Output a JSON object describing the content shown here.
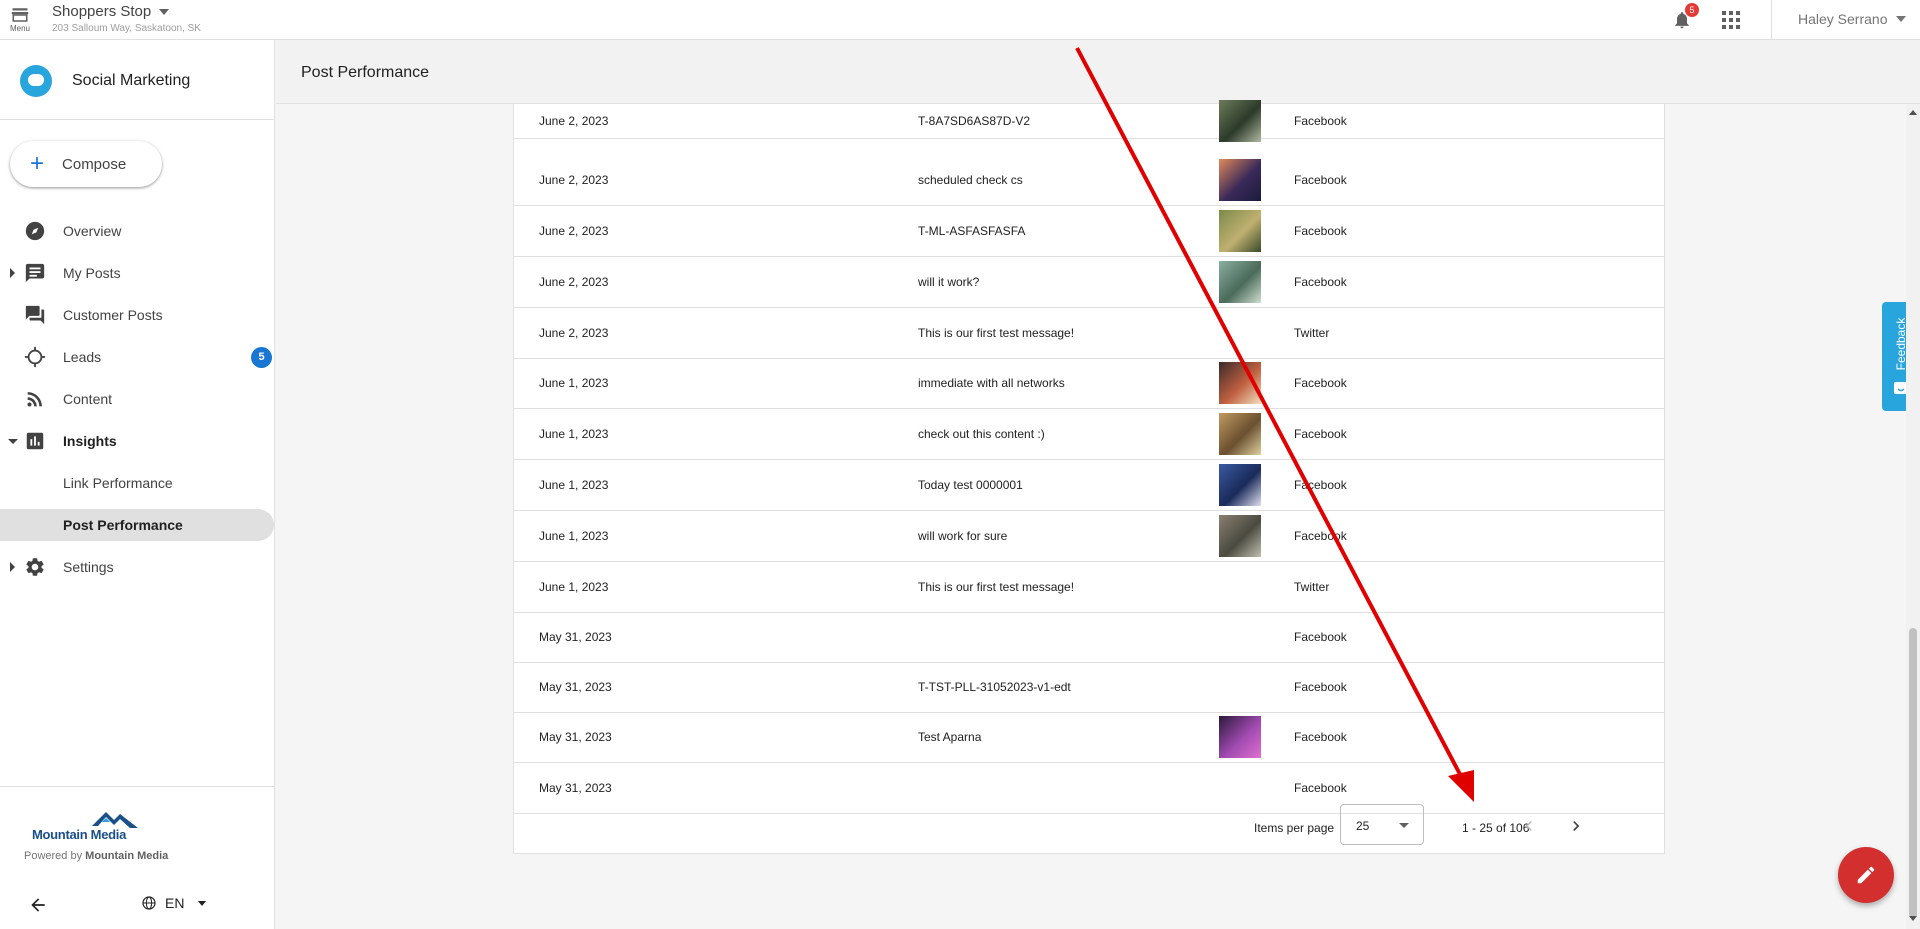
{
  "topbar": {
    "menu_label": "Menu",
    "store_name": "Shoppers Stop",
    "store_address": "203 Salloum Way, Saskatoon, SK",
    "notification_count": "5",
    "user_name": "Haley Serrano"
  },
  "sidebar": {
    "brand_title": "Social Marketing",
    "compose_label": "Compose",
    "items": [
      {
        "label": "Overview",
        "icon": "compass-icon"
      },
      {
        "label": "My Posts",
        "icon": "chat-icon"
      },
      {
        "label": "Customer Posts",
        "icon": "forum-icon"
      },
      {
        "label": "Leads",
        "icon": "crosshair-icon",
        "badge": "5"
      },
      {
        "label": "Content",
        "icon": "rss-icon"
      },
      {
        "label": "Insights",
        "icon": "chart-icon"
      },
      {
        "label": "Link Performance"
      },
      {
        "label": "Post Performance"
      },
      {
        "label": "Settings",
        "icon": "gear-icon"
      }
    ],
    "logo_text": "Mountain Media",
    "powered_prefix": "Powered by",
    "powered_brand": "Mountain Media",
    "language": "EN"
  },
  "page": {
    "title": "Post Performance"
  },
  "table": {
    "rows": [
      {
        "date": "June 2, 2023",
        "message": "T-8A7SD6AS87D-V2",
        "network": "Facebook",
        "thumb": "a"
      },
      {
        "date": "June 2, 2023",
        "message": "scheduled check cs",
        "network": "Facebook",
        "thumb": "b"
      },
      {
        "date": "June 2, 2023",
        "message": "T-ML-ASFASFASFA",
        "network": "Facebook",
        "thumb": "c"
      },
      {
        "date": "June 2, 2023",
        "message": "will it work?",
        "network": "Facebook",
        "thumb": "d"
      },
      {
        "date": "June 2, 2023",
        "message": "This is our first test message!",
        "network": "Twitter",
        "thumb": ""
      },
      {
        "date": "June 1, 2023",
        "message": "immediate with all networks",
        "network": "Facebook",
        "thumb": "e"
      },
      {
        "date": "June 1, 2023",
        "message": "check out this content :)",
        "network": "Facebook",
        "thumb": "f"
      },
      {
        "date": "June 1, 2023",
        "message": "Today test 0000001",
        "network": "Facebook",
        "thumb": "g"
      },
      {
        "date": "June 1, 2023",
        "message": "will work for sure",
        "network": "Facebook",
        "thumb": "h"
      },
      {
        "date": "June 1, 2023",
        "message": "This is our first test message!",
        "network": "Twitter",
        "thumb": ""
      },
      {
        "date": "May 31, 2023",
        "message": "",
        "network": "Facebook",
        "thumb": ""
      },
      {
        "date": "May 31, 2023",
        "message": "T-TST-PLL-31052023-v1-edt",
        "network": "Facebook",
        "thumb": ""
      },
      {
        "date": "May 31, 2023",
        "message": "Test Aparna",
        "network": "Facebook",
        "thumb": "i"
      },
      {
        "date": "May 31, 2023",
        "message": "",
        "network": "Facebook",
        "thumb": ""
      }
    ]
  },
  "pager": {
    "items_per_page_label": "Items per page",
    "items_per_page_value": "25",
    "range_label": "1 - 25 of 106"
  },
  "feedback_label": "Feedback",
  "colors": {
    "accent": "#1976d2",
    "brand": "#29a5dd",
    "fab": "#d32f2f",
    "annotation": "#e00000"
  }
}
